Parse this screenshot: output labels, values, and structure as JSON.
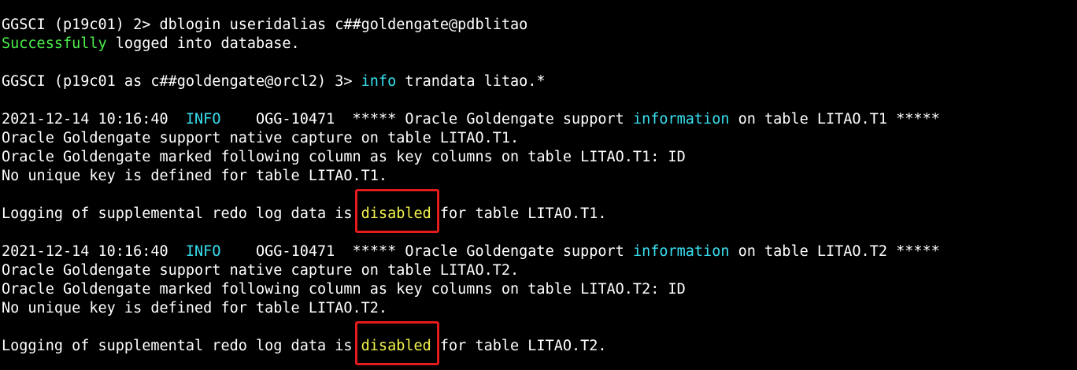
{
  "colors": {
    "background": "#000000",
    "text": "#ffffff",
    "success_green": "#4cf04c",
    "keyword_cyan": "#38e0f0",
    "highlight_yellow": "#f4f44c",
    "annotation_red": "#e51b1b"
  },
  "session": {
    "cmd1": {
      "prompt": "GGSCI (p19c01) 2> ",
      "command": "dblogin useridalias c##goldengate@pdblitao"
    },
    "login_result": {
      "success_word": "Successfully",
      "rest": " logged into database."
    },
    "cmd2": {
      "prompt": "GGSCI (p19c01 as c##goldengate@orcl2) 3> ",
      "keyword": "info",
      "args": " trandata litao.*"
    }
  },
  "blocks": [
    {
      "timestamp": "2021-12-14 10:16:40  ",
      "level": "INFO",
      "code_and_msg": "    OGG-10471  ***** Oracle Goldengate support ",
      "info_word": "information",
      "msg_tail": " on table LITAO.T1 *****",
      "line2": "Oracle Goldengate support native capture on table LITAO.T1.",
      "line3": "Oracle Goldengate marked following column as key columns on table LITAO.T1: ID",
      "line4": "No unique key is defined for table LITAO.T1.",
      "logging_prefix": "Logging of supplemental redo log data is ",
      "status": "disabled",
      "logging_suffix": " for table LITAO.T1."
    },
    {
      "timestamp": "2021-12-14 10:16:40  ",
      "level": "INFO",
      "code_and_msg": "    OGG-10471  ***** Oracle Goldengate support ",
      "info_word": "information",
      "msg_tail": " on table LITAO.T2 *****",
      "line2": "Oracle Goldengate support native capture on table LITAO.T2.",
      "line3": "Oracle Goldengate marked following column as key columns on table LITAO.T2: ID",
      "line4": "No unique key is defined for table LITAO.T2.",
      "logging_prefix": "Logging of supplemental redo log data is ",
      "status": "disabled",
      "logging_suffix": " for table LITAO.T2."
    }
  ]
}
